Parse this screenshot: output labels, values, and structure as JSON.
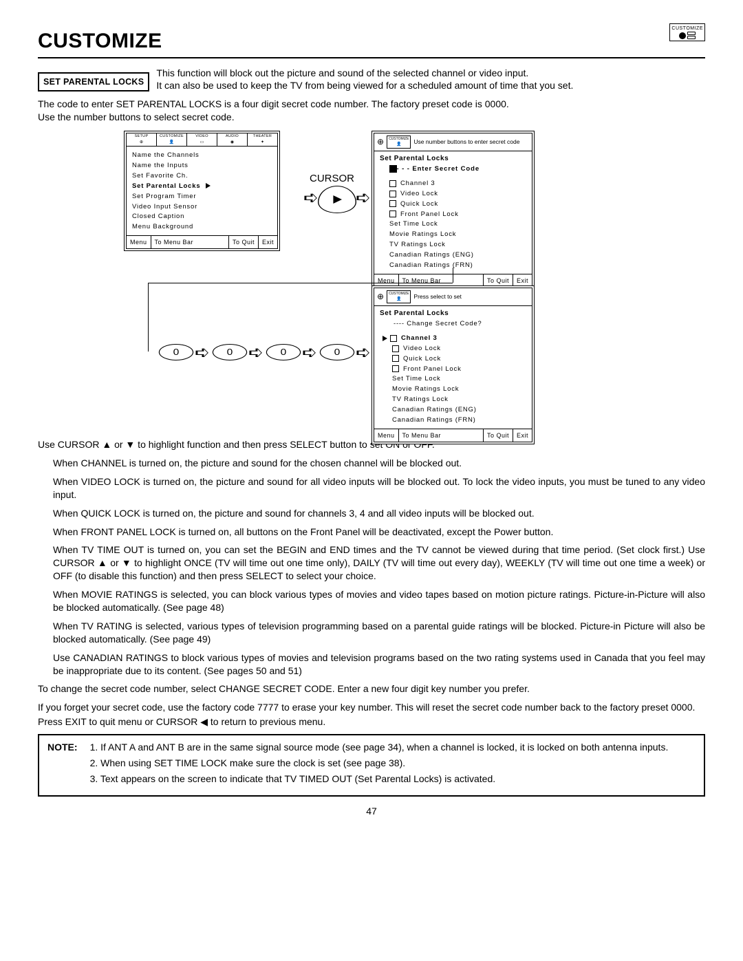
{
  "header": {
    "title": "CUSTOMIZE",
    "corner_icon_label": "CUSTOMIZE"
  },
  "section_label": "SET PARENTAL LOCKS",
  "intro_line1": "This function will block out the picture and sound of the selected channel or video input.",
  "intro_line2": "It can also be used to keep the TV from being viewed for a scheduled amount of time that you set.",
  "para1a": "The code to enter SET PARENTAL LOCKS is a four digit secret code number.  The factory preset code is 0000.",
  "para1b": "Use the number buttons to select secret code.",
  "cursor_label": "CURSOR",
  "zero": "0",
  "osd_tabs": {
    "setup": "SETUP",
    "customize": "CUSTOMIZE",
    "video": "VIDEO",
    "audio": "AUDIO",
    "theater": "THEATER"
  },
  "osd1_items": [
    "Name the Channels",
    "Name the Inputs",
    "Set Favorite Ch.",
    "Set Parental Locks",
    "Set Program Timer",
    "Video Input Sensor",
    "Closed Caption",
    "Menu Background"
  ],
  "osd2_hint": "Use number buttons to enter secret code",
  "osd2_title": "Set Parental Locks",
  "osd2_prompt": "- - -  Enter Secret Code",
  "osd2_items": [
    "Channel 3",
    "Video Lock",
    "Quick Lock",
    "Front Panel Lock",
    "Set Time Lock",
    "Movie Ratings Lock",
    "TV Ratings Lock",
    "Canadian Ratings (ENG)",
    "Canadian Ratings (FRN)"
  ],
  "osd3_hint": "Press select to set",
  "osd3_title": "Set Parental Locks",
  "osd3_prompt": "----  Change Secret Code?",
  "osd3_items": [
    "Channel 3",
    "Video Lock",
    "Quick Lock",
    "Front Panel Lock",
    "Set Time Lock",
    "Movie Ratings Lock",
    "TV Ratings Lock",
    "Canadian Ratings (ENG)",
    "Canadian Ratings (FRN)"
  ],
  "osd_foot_menu": "Menu",
  "osd_foot_bar": "To Menu Bar",
  "osd_foot_quit": "To Quit",
  "osd_foot_exit": "Exit",
  "para_cursor": "Use CURSOR ▲ or ▼ to highlight function and then press SELECT button to set ON or OFF.",
  "p_channel": "When CHANNEL is turned on, the picture and sound for the chosen channel will be blocked out.",
  "p_video": "When VIDEO LOCK is turned on, the picture and sound for all video inputs will be blocked out. To lock the video inputs, you must be tuned to any video input.",
  "p_quick": "When QUICK LOCK is turned on, the picture and sound for channels 3, 4 and all video inputs will be blocked out.",
  "p_front": "When FRONT PANEL LOCK is turned on, all buttons on the Front Panel will be deactivated, except the Power button.",
  "p_time": "When TV TIME OUT is turned on, you can set the BEGIN and END times and the TV cannot be viewed during that time period. (Set clock first.) Use CURSOR ▲ or ▼ to highlight ONCE (TV will time out one time only), DAILY (TV will time out every day), WEEKLY (TV will time out one time a week) or OFF (to disable this function) and then press SELECT to select your choice.",
  "p_movie": "When MOVIE RATINGS is selected, you can block various types of movies and video tapes based on motion picture ratings.  Picture-in-Picture will also be blocked automatically. (See page 48)",
  "p_tvrate": "When TV RATING is selected, various types of television programming based on a parental guide ratings will be blocked.  Picture-in Picture will also be blocked automatically.  (See page 49)",
  "p_canada": "Use CANADIAN RATINGS to block various types of movies and television programs based on the two rating systems used in Canada that you feel may be inappropriate due to its content.  (See pages 50 and 51)",
  "p_change": "To change the secret code number, select CHANGE SECRET CODE.  Enter a new four digit key number you prefer.",
  "p_forget": "If you forget your secret code, use the factory code 7777 to erase your key number. This will reset the secret code number back to the factory preset 0000.",
  "p_exit": "Press EXIT to quit menu or CURSOR ◀ to return to previous menu.",
  "note_label": "NOTE:",
  "notes": [
    "1. If ANT A and ANT B are in the same signal source mode (see page 34), when a channel is locked, it is locked on both antenna inputs.",
    "2. When using SET TIME LOCK make sure the clock is set (see page 38).",
    "3. Text appears on the screen to indicate that TV TIMED OUT (Set Parental Locks) is activated."
  ],
  "page_number": "47"
}
